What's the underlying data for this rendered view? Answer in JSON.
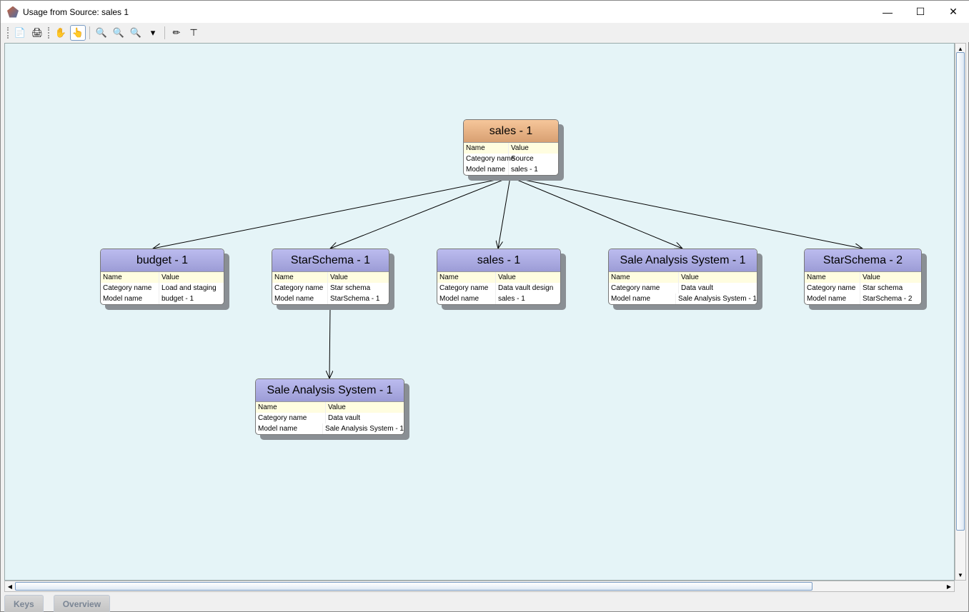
{
  "window": {
    "title": "Usage from Source: sales 1",
    "minimize": "—",
    "maximize": "☐",
    "close": "✕"
  },
  "toolbar": [
    {
      "icon": "pdf-export-icon",
      "glyph": "📄"
    },
    {
      "icon": "print-icon",
      "glyph": "🖨"
    },
    {
      "icon": "pan-hand-icon",
      "glyph": "✋"
    },
    {
      "icon": "select-hand-icon",
      "glyph": "👆",
      "active": true
    },
    {
      "icon": "zoom-in-icon",
      "glyph": "🔍"
    },
    {
      "icon": "zoom-out-icon",
      "glyph": "🔍"
    },
    {
      "icon": "zoom-icon",
      "glyph": "🔍"
    },
    {
      "icon": "dropdown-arrow-icon",
      "glyph": "▾"
    },
    {
      "icon": "pencil-icon",
      "glyph": "✏"
    },
    {
      "icon": "layout-tree-icon",
      "glyph": "⊤"
    }
  ],
  "table_headers": {
    "name": "Name",
    "value": "Value"
  },
  "nodes": [
    {
      "id": "n0",
      "title": "sales - 1",
      "type": "source",
      "rows": [
        [
          "Category name",
          "Source"
        ],
        [
          "Model name",
          "sales - 1"
        ]
      ]
    },
    {
      "id": "n1",
      "title": "budget - 1",
      "rows": [
        [
          "Category name",
          "Load and staging"
        ],
        [
          "Model name",
          "budget - 1"
        ]
      ]
    },
    {
      "id": "n2",
      "title": "StarSchema - 1",
      "rows": [
        [
          "Category name",
          "Star schema"
        ],
        [
          "Model name",
          "StarSchema - 1"
        ]
      ]
    },
    {
      "id": "n3",
      "title": "sales - 1",
      "rows": [
        [
          "Category name",
          "Data vault design"
        ],
        [
          "Model name",
          "sales - 1"
        ]
      ]
    },
    {
      "id": "n4",
      "title": "Sale Analysis System - 1",
      "rows": [
        [
          "Category name",
          "Data vault"
        ],
        [
          "Model name",
          "Sale Analysis System - 1"
        ]
      ]
    },
    {
      "id": "n5",
      "title": "StarSchema - 2",
      "rows": [
        [
          "Category name",
          "Star schema"
        ],
        [
          "Model name",
          "StarSchema - 2"
        ]
      ]
    },
    {
      "id": "n6",
      "title": "Sale Analysis System - 1",
      "rows": [
        [
          "Category name",
          "Data vault"
        ],
        [
          "Model name",
          "Sale Analysis System - 1"
        ]
      ]
    }
  ],
  "edges": [
    [
      "n0",
      "n1"
    ],
    [
      "n0",
      "n2"
    ],
    [
      "n0",
      "n3"
    ],
    [
      "n0",
      "n4"
    ],
    [
      "n0",
      "n5"
    ],
    [
      "n2",
      "n6"
    ]
  ],
  "tabs": [
    "Keys",
    "Overview"
  ],
  "colors": {
    "canvas": "#e5f4f7",
    "node_header": "#a8a8e0",
    "source_header": "#e8b486",
    "name_row": "#fffde0"
  }
}
